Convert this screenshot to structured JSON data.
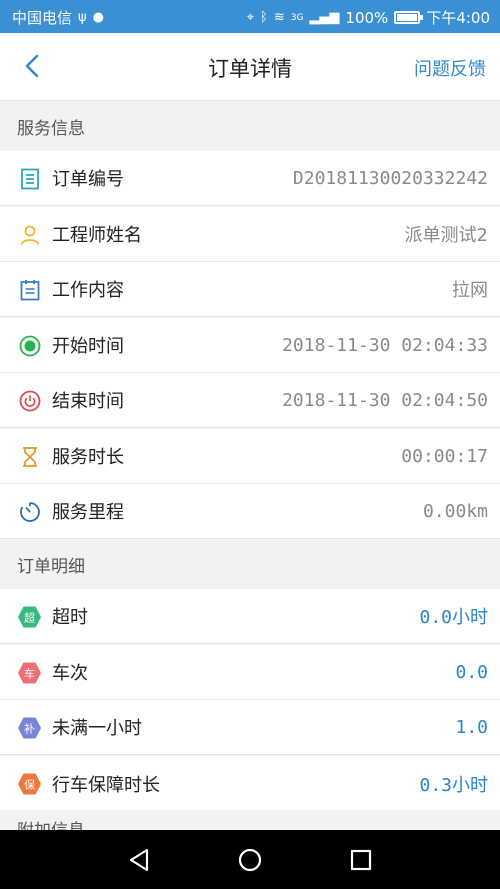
{
  "status_bar": {
    "carrier": "中国电信",
    "network": "3G",
    "battery": "100%",
    "time": "下午4:00"
  },
  "nav": {
    "title": "订单详情",
    "feedback": "问题反馈"
  },
  "service_section": {
    "header": "服务信息",
    "rows": [
      {
        "label": "订单编号",
        "value": "D2018113002033​2242",
        "icon": "document-icon"
      },
      {
        "label": "工程师姓名",
        "value": "派单测试2",
        "icon": "person-icon"
      },
      {
        "label": "工作内容",
        "value": "拉网",
        "icon": "clipboard-icon"
      },
      {
        "label": "开始时间",
        "value": "2018-11-30 02:04:33",
        "icon": "start-icon"
      },
      {
        "label": "结束时间",
        "value": "2018-11-30 02:04:50",
        "icon": "power-icon"
      },
      {
        "label": "服务时长",
        "value": "00:00:17",
        "icon": "hourglass-icon"
      },
      {
        "label": "服务里程",
        "value": "0.00km",
        "icon": "timer-icon"
      }
    ]
  },
  "detail_section": {
    "header": "订单明细",
    "rows": [
      {
        "label": "超时",
        "value": "0.0小时",
        "badge": "超",
        "color": "#37b97f",
        "icon": "overtime-badge-icon"
      },
      {
        "label": "车次",
        "value": "0.0",
        "badge": "车",
        "color": "#ee6f76",
        "icon": "trips-badge-icon"
      },
      {
        "label": "未满一小时",
        "value": "1.0",
        "badge": "补",
        "color": "#7a85d8",
        "icon": "supplement-badge-icon"
      },
      {
        "label": "行车保障时长",
        "value": "0.3小时",
        "badge": "保",
        "color": "#f0783a",
        "icon": "guarantee-badge-icon"
      }
    ]
  },
  "partial_section": {
    "header": "附加信息"
  },
  "colors": {
    "primary": "#3b8fd3",
    "link": "#2f88d0",
    "value_blue": "#2a85c7"
  }
}
